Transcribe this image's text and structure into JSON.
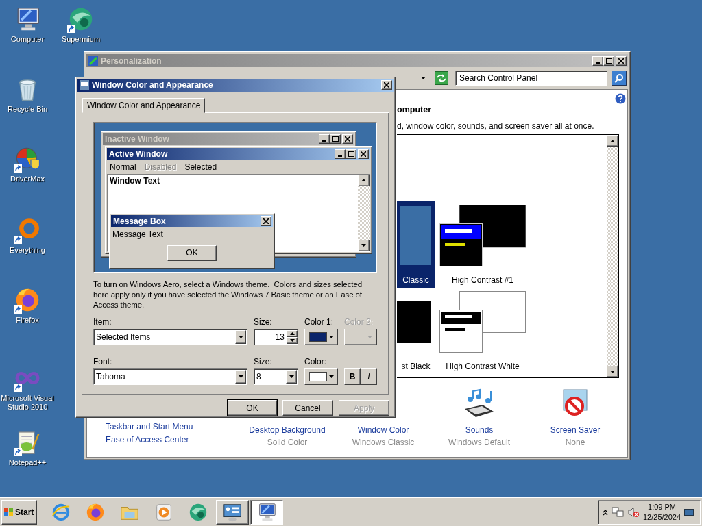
{
  "desktop_icons": [
    {
      "label": "Computer",
      "kind": "monitor"
    },
    {
      "label": "Supermium",
      "kind": "sphere"
    },
    {
      "label": "Recycle Bin",
      "kind": "bin"
    },
    {
      "label": "DriverMax",
      "kind": "gear"
    },
    {
      "label": "Everything",
      "kind": "ring"
    },
    {
      "label": "Firefox",
      "kind": "browser"
    },
    {
      "label": "Microsoft Visual Studio 2010",
      "kind": "infinity"
    },
    {
      "label": "Notepad++",
      "kind": "notepad"
    }
  ],
  "personalization": {
    "title": "Personalization",
    "search": {
      "placeholder": "Search Control Panel"
    },
    "heading": "omputer",
    "description": "d, window color, sounds, and screen saver all at once.",
    "themes": [
      {
        "label": "Classic",
        "kind": "classic",
        "selected": true
      },
      {
        "label": "High Contrast #1",
        "kind": "contrast_one",
        "selected": false
      },
      {
        "label": "st Black",
        "kind": "black",
        "selected": false
      },
      {
        "label": "High Contrast White",
        "kind": "white",
        "selected": false
      }
    ],
    "links": [
      "Taskbar and Start Menu",
      "Ease of Access Center"
    ],
    "options": [
      {
        "label": "Desktop Background",
        "value": "Solid Color"
      },
      {
        "label": "Window Color",
        "value": "Windows Classic"
      },
      {
        "label": "Sounds",
        "value": "Windows Default"
      },
      {
        "label": "Screen Saver",
        "value": "None"
      }
    ]
  },
  "dialog": {
    "title": "Window Color and Appearance",
    "tabs": [
      {
        "label": "Window Color and Appearance",
        "selected": true
      }
    ],
    "preview": {
      "inactive_title": "Inactive Window",
      "active_title": "Active Window",
      "menu": [
        {
          "label": "Normal",
          "disabled": false
        },
        {
          "label": "Disabled",
          "disabled": true
        },
        {
          "label": "Selected",
          "disabled": false
        }
      ],
      "window_text": "Window Text",
      "message_title": "Message Box",
      "message_text": "Message Text",
      "message_button": "OK"
    },
    "note": "To turn on Windows Aero, select a Windows theme.  Colors and sizes selected here apply only if you have selected the Windows 7 Basic theme or an Ease of Access theme.",
    "item": {
      "label": "Item:",
      "value": "Selected Items"
    },
    "item_size": {
      "label": "Size:",
      "value": "13"
    },
    "color1": {
      "label": "Color 1:",
      "color": "#0a246a",
      "disabled": false
    },
    "color2": {
      "label": "Color 2:",
      "disabled": true
    },
    "font": {
      "label": "Font:",
      "value": "Tahoma"
    },
    "font_size": {
      "label": "Size:",
      "value": "8"
    },
    "font_color": {
      "label": "Color:",
      "color": "#ffffff"
    },
    "bold": "B",
    "italic": "I",
    "buttons": [
      {
        "label": "OK",
        "disabled": false
      },
      {
        "label": "Cancel",
        "disabled": false
      },
      {
        "label": "Apply",
        "disabled": true
      }
    ]
  },
  "taskbar": {
    "start": "Start",
    "apps": [
      {
        "kind": "globe",
        "selected": false
      },
      {
        "kind": "browser",
        "selected": false
      },
      {
        "kind": "folder",
        "selected": false
      },
      {
        "kind": "play",
        "selected": false
      },
      {
        "kind": "sphere",
        "selected": false
      },
      {
        "kind": "panel",
        "selected": false
      },
      {
        "kind": "monitor",
        "selected": true
      }
    ],
    "time": "1:09 PM",
    "date": "12/25/2024"
  }
}
